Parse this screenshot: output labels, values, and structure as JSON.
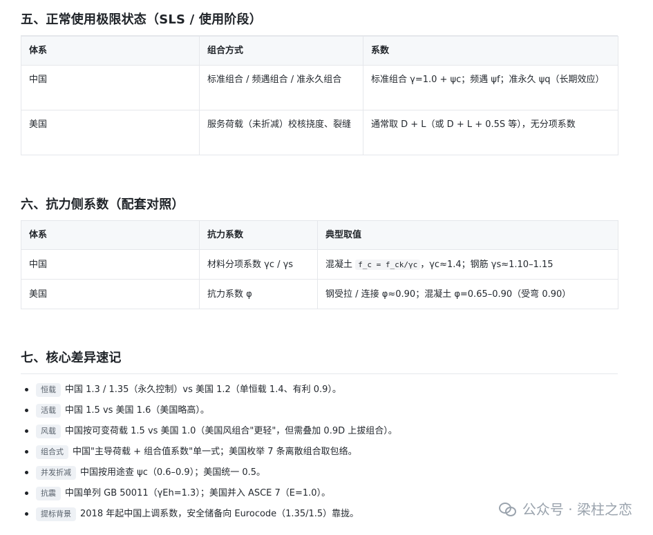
{
  "sections": {
    "s5": {
      "title": "五、正常使用极限状态（SLS / 使用阶段）",
      "headers": [
        "体系",
        "组合方式",
        "系数"
      ],
      "rows": [
        [
          "中国",
          "标准组合 / 频遇组合 / 准永久组合",
          "标准组合 γ=1.0 + ψc；频遇 ψf；准永久 ψq（长期效应）"
        ],
        [
          "美国",
          "服务荷载（未折减）校核挠度、裂缝",
          "通常取 D + L（或 D + L + 0.5S 等），无分项系数"
        ]
      ]
    },
    "s6": {
      "title": "六、抗力侧系数（配套对照）",
      "headers": [
        "体系",
        "抗力系数",
        "典型取值"
      ],
      "rows": [
        {
          "a": "中国",
          "b": "材料分项系数 γc / γs",
          "c_pre": "混凝土 ",
          "c_code": "f_c = f_ck/γc",
          "c_post": "，γc≈1.4；钢筋 γs≈1.10–1.15"
        },
        {
          "a": "美国",
          "b": "抗力系数 φ",
          "c_pre": "钢受拉 / 连接 φ≈0.90；混凝土 φ=0.65–0.90（受弯 0.90）",
          "c_code": "",
          "c_post": ""
        }
      ]
    },
    "s7": {
      "title": "七、核心差异速记",
      "items": [
        {
          "tag": "恒载",
          "text": "中国 1.3 / 1.35（永久控制）vs 美国 1.2（单恒载 1.4、有利 0.9）。"
        },
        {
          "tag": "活载",
          "text": "中国 1.5 vs 美国 1.6（美国略高）。"
        },
        {
          "tag": "风载",
          "text": "中国按可变荷载 1.5 vs 美国 1.0（美国风组合\"更轻\"，但需叠加 0.9D 上拔组合）。"
        },
        {
          "tag": "组合式",
          "text": "中国\"主导荷载 + 组合值系数\"单一式；美国枚举 7 条离散组合取包络。"
        },
        {
          "tag": "并发折减",
          "text": "中国按用途查 ψc（0.6–0.9）；美国统一 0.5。"
        },
        {
          "tag": "抗震",
          "text": "中国单列 GB 50011（γEh=1.3）；美国并入 ASCE 7（E=1.0）。"
        },
        {
          "tag": "提标背景",
          "text": "2018 年起中国上调系数，安全储备向 Eurocode（1.35/1.5）靠拢。"
        }
      ]
    }
  },
  "watermark": "公众号 · 梁柱之恋"
}
